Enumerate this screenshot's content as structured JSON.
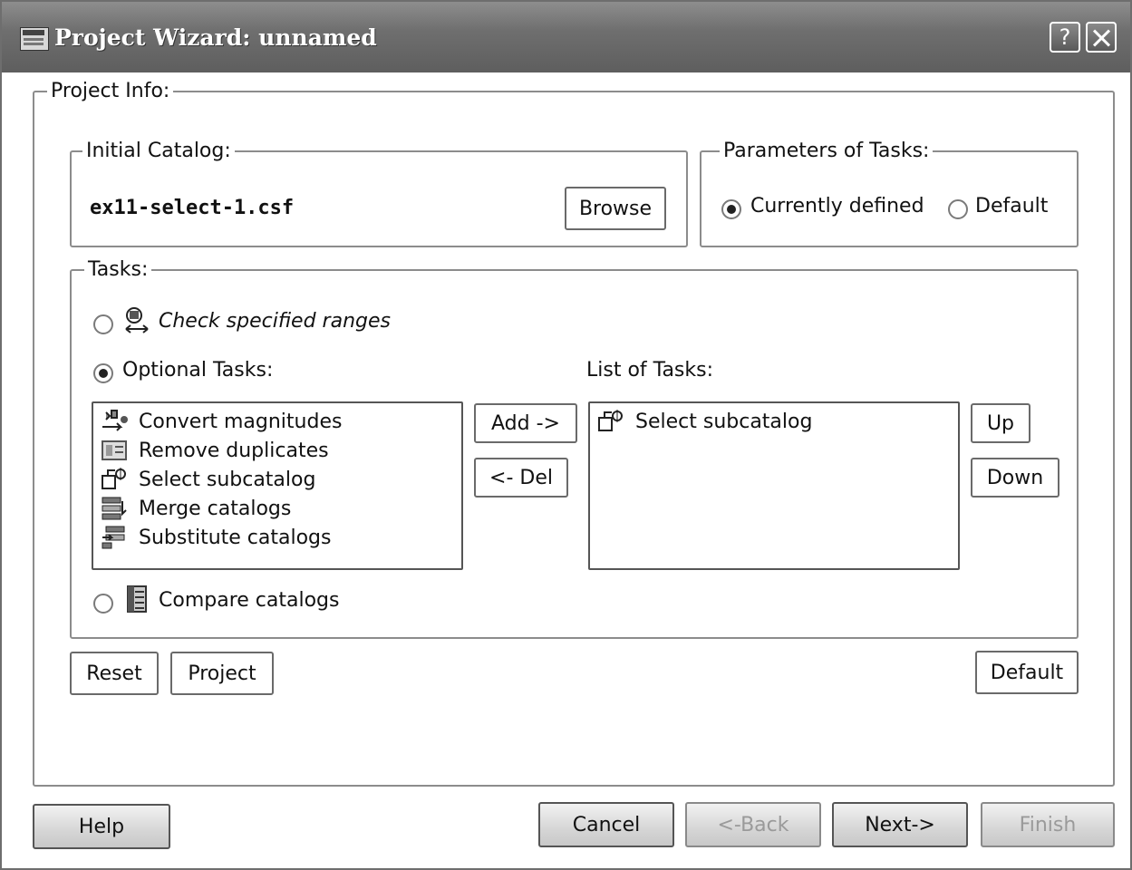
{
  "window": {
    "title": "Project Wizard: unnamed",
    "help_button": "?"
  },
  "project_info": {
    "legend": "Project Info:",
    "initial_catalog": {
      "legend": "Initial Catalog:",
      "file": "ex11-select-1.csf",
      "browse_label": "Browse"
    },
    "parameters": {
      "legend": "Parameters of Tasks:",
      "options": [
        "Currently defined",
        "Default"
      ],
      "selected": "Currently defined"
    },
    "tasks": {
      "legend": "Tasks:",
      "check_ranges_label": "Check specified ranges",
      "optional_tasks_label": "Optional Tasks:",
      "list_of_tasks_label": "List of Tasks:",
      "optional_tasks": [
        {
          "label": "Convert magnitudes",
          "icon": "convert-magnitudes-icon"
        },
        {
          "label": "Remove duplicates",
          "icon": "remove-duplicates-icon"
        },
        {
          "label": "Select subcatalog",
          "icon": "select-subcatalog-icon"
        },
        {
          "label": "Merge catalogs",
          "icon": "merge-catalogs-icon"
        },
        {
          "label": "Substitute catalogs",
          "icon": "substitute-catalogs-icon"
        }
      ],
      "list_of_tasks": [
        {
          "label": "Select subcatalog",
          "icon": "select-subcatalog-icon"
        }
      ],
      "add_label": "Add ->",
      "del_label": "<- Del",
      "up_label": "Up",
      "down_label": "Down",
      "compare_label": "Compare catalogs",
      "selected_mode": "Optional Tasks:"
    },
    "reset_label": "Reset",
    "project_label": "Project",
    "default_label": "Default"
  },
  "footer": {
    "help_label": "Help",
    "cancel_label": "Cancel",
    "back_label": "<-Back",
    "next_label": "Next->",
    "finish_label": "Finish"
  }
}
